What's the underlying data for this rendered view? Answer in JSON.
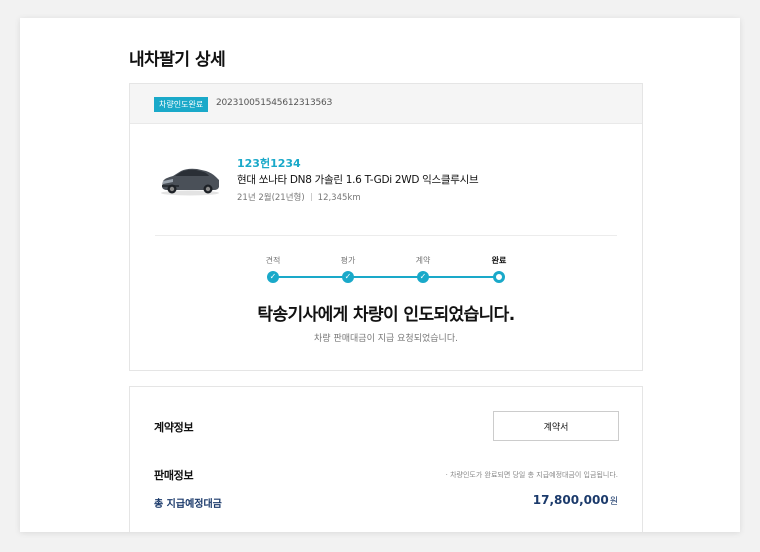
{
  "page": {
    "title": "내차팔기 상세"
  },
  "order": {
    "status_badge": "차량인도완료",
    "number": "20231005154561231356З"
  },
  "car": {
    "plate": "123헌1234",
    "model": "현대 쏘나타 DN8 가솔린 1.6 T-GDi 2WD 익스클루시브",
    "registration": "21년 2월(21년형)",
    "mileage": "12,345km"
  },
  "progress": {
    "steps": [
      {
        "label": "견적",
        "state": "done"
      },
      {
        "label": "평가",
        "state": "done"
      },
      {
        "label": "계약",
        "state": "done"
      },
      {
        "label": "완료",
        "state": "current"
      }
    ],
    "check_glyph": "✓"
  },
  "status": {
    "headline": "탁송기사에게 차량이 인도되었습니다.",
    "subline": "차량 판매대금이 지급 요청되었습니다."
  },
  "contract": {
    "title": "계약정보",
    "button_label": "계약서"
  },
  "sale": {
    "title": "판매정보",
    "notice": "· 차량인도가 완료되면 당일 총 지급예정대금이 입금됩니다.",
    "total_label": "총 지급예정대금",
    "total_value": "17,800,000",
    "total_unit": "원"
  },
  "colors": {
    "accent": "#1aa9c9",
    "navy": "#1b3a6b",
    "icon": "car-thumbnail"
  }
}
